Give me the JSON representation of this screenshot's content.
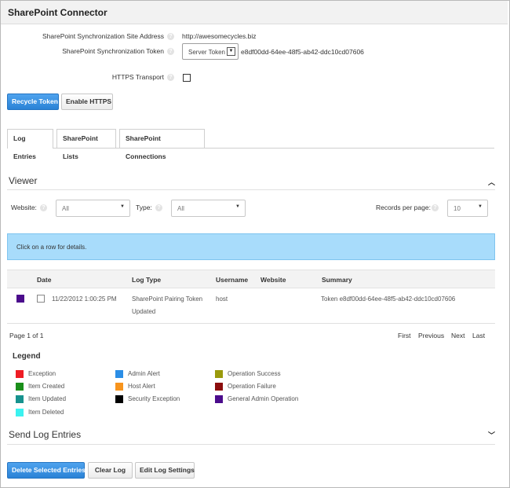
{
  "title": "SharePoint Connector",
  "settings": {
    "site_label": "SharePoint Synchronization Site Address",
    "site_value": "http://awesomecycles.biz",
    "token_label": "SharePoint Synchronization Token",
    "token_select": "Server Token",
    "token_value": "e8df00dd-64ee-48f5-ab42-ddc10cd07606",
    "https_label": "HTTPS Transport",
    "https_checked": false
  },
  "buttons": {
    "recycle": "Recycle Token",
    "enable_https": "Enable HTTPS"
  },
  "tabs": [
    "Log Entries",
    "SharePoint Lists",
    "SharePoint Connections"
  ],
  "viewer": {
    "title": "Viewer",
    "website_label": "Website:",
    "website_value": "All",
    "type_label": "Type:",
    "type_value": "All",
    "records_label": "Records per page:",
    "records_value": "10",
    "info": "Click on a row for details."
  },
  "table": {
    "headers": {
      "date": "Date",
      "log_type": "Log Type",
      "username": "Username",
      "website": "Website",
      "summary": "Summary"
    },
    "rows": [
      {
        "color": "#4b0c8c",
        "date": "11/22/2012 1:00:25 PM",
        "log_type_line1": "SharePoint Pairing Token",
        "log_type_line2": "Updated",
        "username": "host",
        "website": "",
        "summary": "Token e8df00dd-64ee-48f5-ab42-ddc10cd07606"
      }
    ]
  },
  "pager": {
    "page_info": "Page 1 of 1",
    "first": "First",
    "previous": "Previous",
    "next": "Next",
    "last": "Last"
  },
  "legend": {
    "title": "Legend",
    "items": [
      {
        "label": "Exception",
        "color": "#ee1c24"
      },
      {
        "label": "Item Created",
        "color": "#1a8f1a"
      },
      {
        "label": "Item Updated",
        "color": "#17928e"
      },
      {
        "label": "Item Deleted",
        "color": "#3bf2f0"
      },
      {
        "label": "Admin Alert",
        "color": "#2b8ee6"
      },
      {
        "label": "Host Alert",
        "color": "#f7941d"
      },
      {
        "label": "Security Exception",
        "color": "#000000"
      },
      {
        "label": "Operation Success",
        "color": "#9a9a0c"
      },
      {
        "label": "Operation Failure",
        "color": "#8b0d0d"
      },
      {
        "label": "General Admin Operation",
        "color": "#4b0c8c"
      }
    ]
  },
  "send_log": {
    "title": "Send Log Entries"
  },
  "footer": {
    "delete": "Delete Selected Entries",
    "clear": "Clear Log",
    "edit": "Edit Log Settings"
  }
}
